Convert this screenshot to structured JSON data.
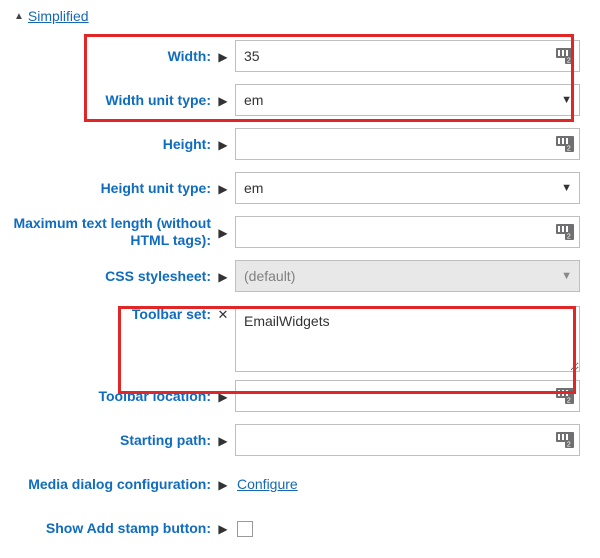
{
  "section": {
    "title": "Simplified"
  },
  "rows": {
    "width": {
      "label": "Width:",
      "value": "35"
    },
    "widthUnit": {
      "label": "Width unit type:",
      "value": "em"
    },
    "height": {
      "label": "Height:",
      "value": ""
    },
    "heightUnit": {
      "label": "Height unit type:",
      "value": "em"
    },
    "maxText": {
      "label": "Maximum text length (without HTML tags):",
      "value": ""
    },
    "cssSheet": {
      "label": "CSS stylesheet:",
      "value": "(default)"
    },
    "toolbarSet": {
      "label": "Toolbar set:",
      "value": "EmailWidgets"
    },
    "toolbarLoc": {
      "label": "Toolbar location:",
      "value": ""
    },
    "startingPath": {
      "label": "Starting path:",
      "value": ""
    },
    "mediaDlg": {
      "label": "Media dialog configuration:",
      "link": "Configure"
    },
    "showStamp": {
      "label": "Show Add stamp button:"
    }
  },
  "glyphs": {
    "expand": "▶",
    "collapse": "▲",
    "clear": "✕",
    "caret": "▼"
  }
}
